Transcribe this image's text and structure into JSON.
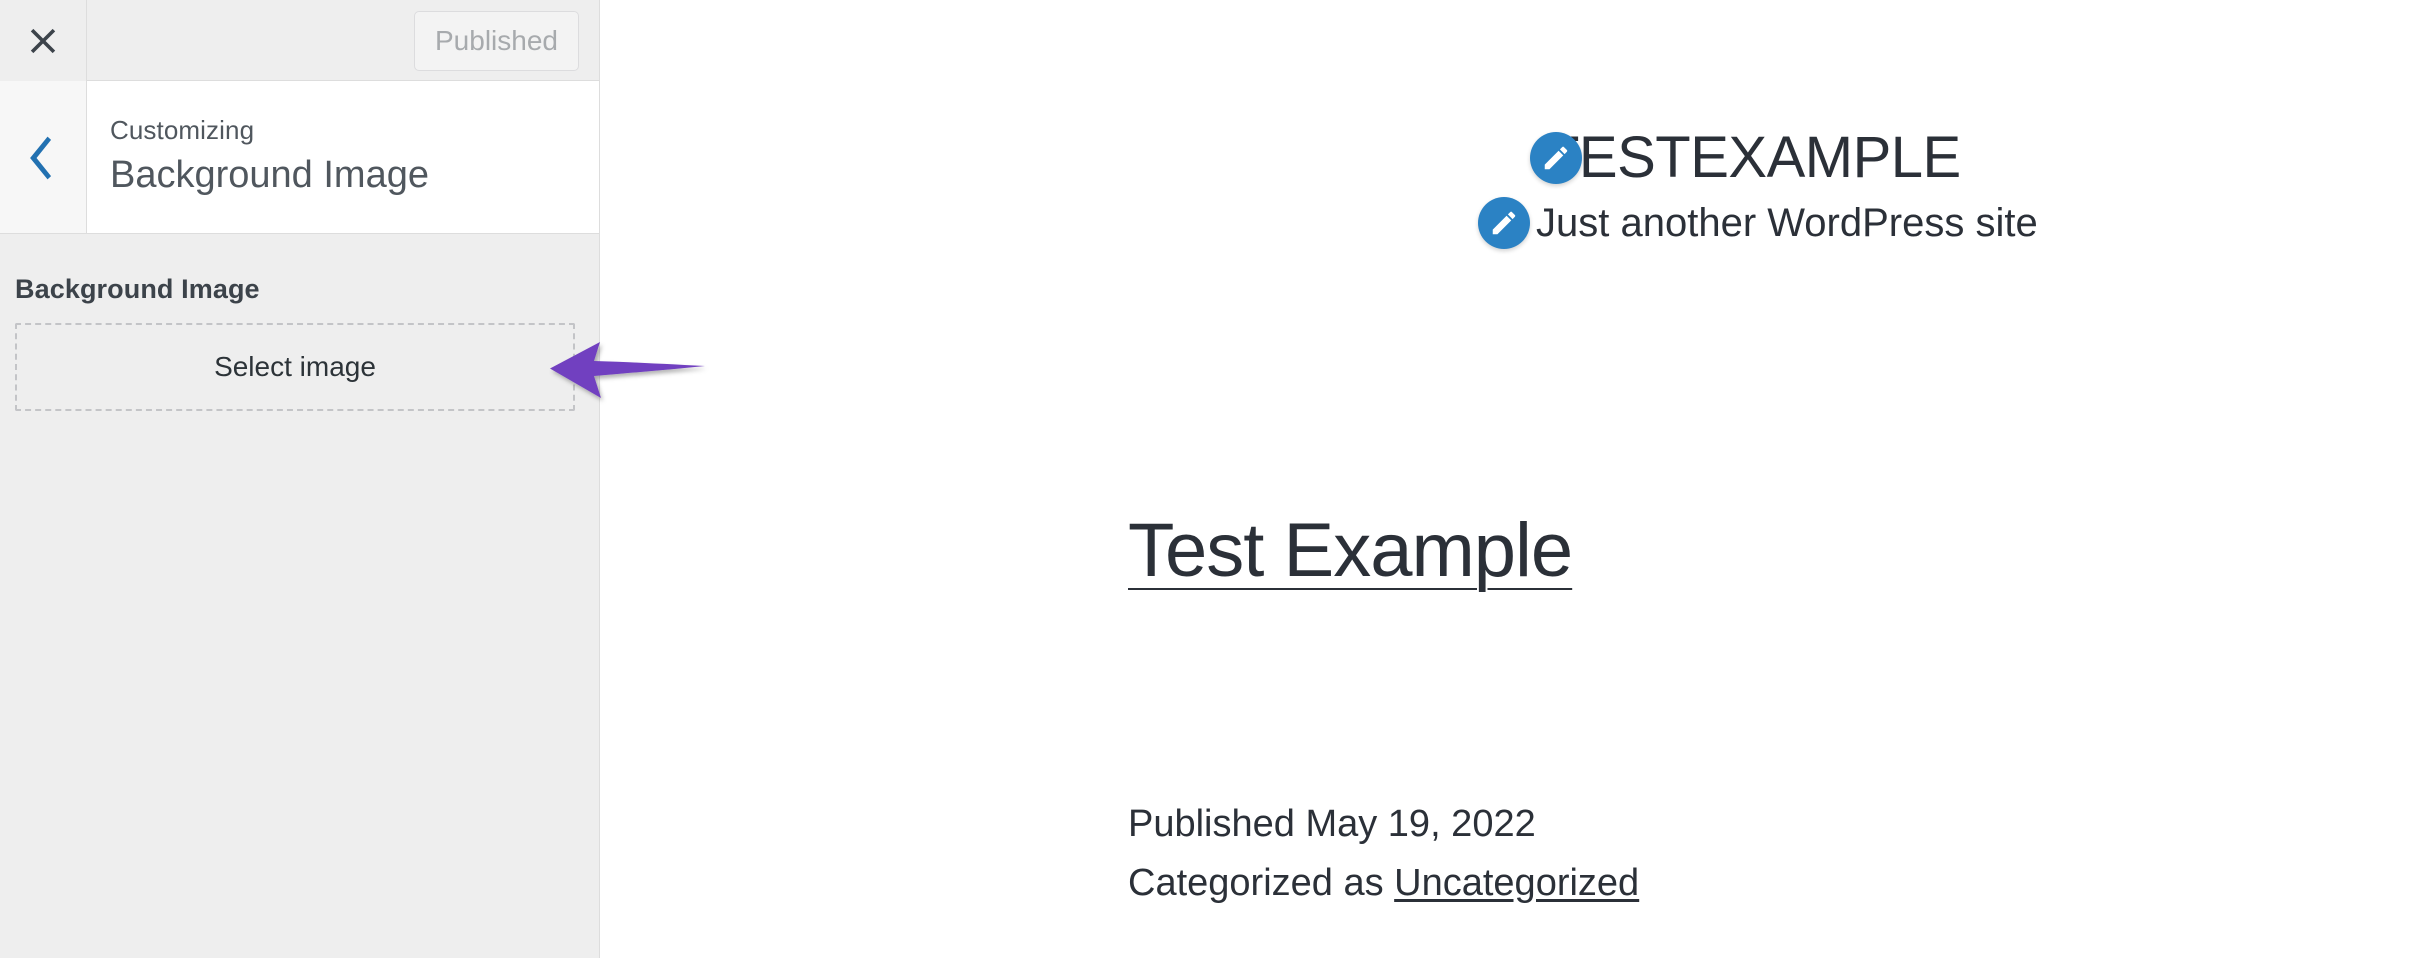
{
  "customizer": {
    "close_icon": "close-x-icon",
    "back_icon": "chevron-left-icon",
    "publish_button_label": "Published",
    "panel_eyebrow": "Customizing",
    "panel_heading": "Background Image",
    "section_label": "Background Image",
    "select_image_label": "Select image",
    "colors": {
      "sidebar_bg": "#eeeeee",
      "panel_bg": "#ffffff",
      "border": "#dddddd",
      "back_chevron": "#2271b1",
      "publish_text": "#a7aaad",
      "heading_text": "#50575e",
      "label_text": "#3c434a"
    }
  },
  "preview": {
    "site_title": "TESTEXAMPLE",
    "site_tagline": "Just another WordPress site",
    "title_edit_icon": "pencil-edit-icon",
    "tagline_edit_icon": "pencil-edit-icon",
    "entry": {
      "title": "Test Example",
      "published_text": "Published May 19, 2022",
      "categorized_prefix": "Categorized as ",
      "category_label": "Uncategorized"
    },
    "colors": {
      "text": "#2b3038",
      "edit_icon_bg": "#2b82c4",
      "page_bg": "#ffffff"
    }
  },
  "annotation": {
    "arrow_name": "arrow-pointing-to-select-image",
    "direction": "left",
    "color": "#7140c0"
  }
}
